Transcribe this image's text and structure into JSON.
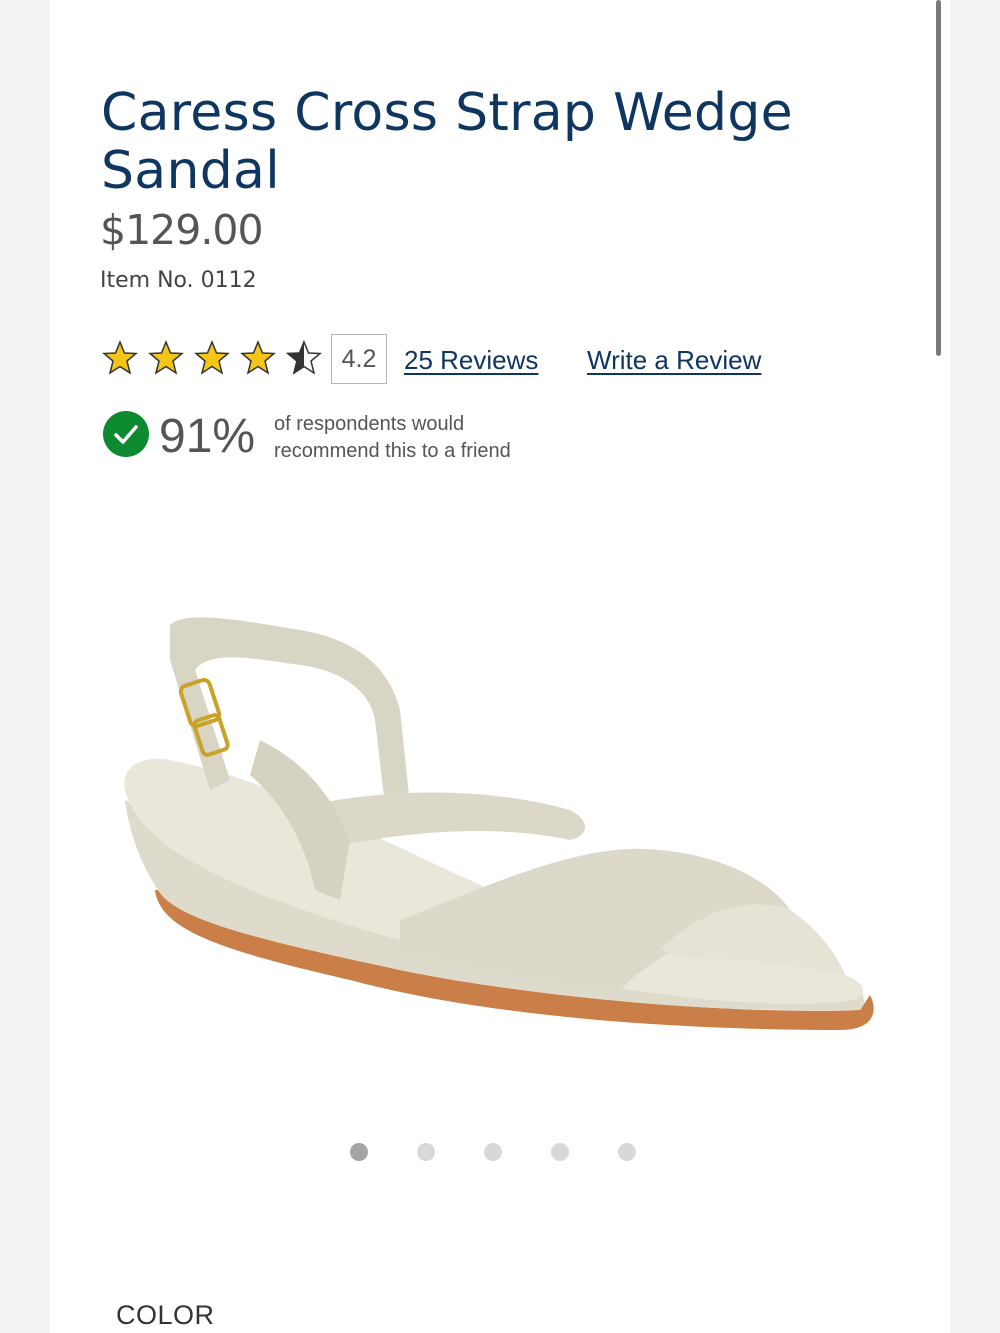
{
  "product": {
    "title": "Caress Cross Strap Wedge Sandal",
    "price": "$129.00",
    "item_number": "Item No. 0112"
  },
  "rating": {
    "stars_value": 4.2,
    "stars_max": 5,
    "score_label": "4.2",
    "reviews_link": "25 Reviews",
    "write_review_link": "Write a Review",
    "star_color": "#f5c518"
  },
  "recommend": {
    "percent": "91%",
    "text": "of respondents would recommend this to a friend",
    "check_color": "#0d8a2f"
  },
  "gallery": {
    "image_alt": "product-image-sandal",
    "total_slides": 5,
    "active_slide": 1
  },
  "options": {
    "color_label": "COLOR"
  },
  "colors": {
    "title": "#0f3561",
    "link": "#0f3561"
  }
}
